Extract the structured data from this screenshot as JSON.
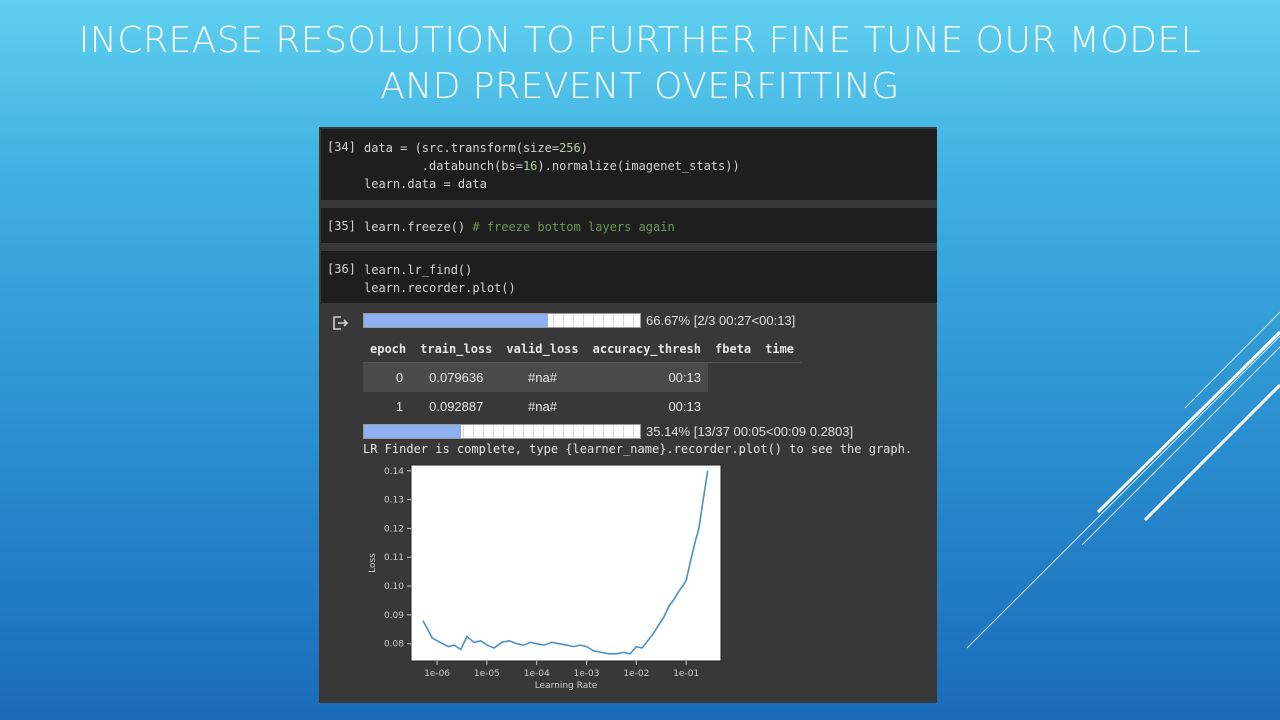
{
  "slide": {
    "title_line1": "INCREASE RESOLUTION TO FURTHER FINE TUNE OUR MODEL",
    "title_line2": "AND PREVENT OVERFITTING"
  },
  "cells": [
    {
      "prompt": "[34]",
      "lines": [
        [
          {
            "t": "data = (src.transform(size="
          },
          {
            "t": "256",
            "c": "num"
          },
          {
            "t": ")"
          }
        ],
        [
          {
            "t": "        .databunch(bs="
          },
          {
            "t": "16",
            "c": "num"
          },
          {
            "t": ").normalize(imagenet_stats))"
          }
        ],
        [
          {
            "t": "learn.data = data"
          }
        ]
      ]
    },
    {
      "prompt": "[35]",
      "lines": [
        [
          {
            "t": "learn.freeze() "
          },
          {
            "t": "# freeze bottom layers again",
            "c": "com"
          }
        ]
      ]
    },
    {
      "prompt": "[36]",
      "lines": [
        [
          {
            "t": "learn.lr_find()"
          }
        ],
        [
          {
            "t": "learn.recorder.plot()"
          }
        ]
      ]
    }
  ],
  "output": {
    "progress1": {
      "fraction": 0.6667,
      "text": "66.67% [2/3 00:27<00:13]"
    },
    "table": {
      "headers": [
        "epoch",
        "train_loss",
        "valid_loss",
        "accuracy_thresh",
        "fbeta",
        "time"
      ],
      "rows": [
        [
          "0",
          "0.079636",
          "#na#",
          "",
          "",
          "00:13"
        ],
        [
          "1",
          "0.092887",
          "#na#",
          "",
          "",
          "00:13"
        ]
      ]
    },
    "progress2": {
      "fraction": 0.3514,
      "text": "35.14% [13/37 00:05<00:09 0.2803]"
    },
    "lr_text": "LR Finder is complete, type {learner_name}.recorder.plot() to see the graph."
  },
  "chart_data": {
    "type": "line",
    "xlabel": "Learning Rate",
    "ylabel": "Loss",
    "x_scale": "log",
    "xlim": [
      3e-07,
      0.5
    ],
    "ylim": [
      0.074,
      0.142
    ],
    "x_ticks": [
      {
        "v": 1e-06,
        "label": "1e-06"
      },
      {
        "v": 1e-05,
        "label": "1e-05"
      },
      {
        "v": 0.0001,
        "label": "1e-04"
      },
      {
        "v": 0.001,
        "label": "1e-03"
      },
      {
        "v": 0.01,
        "label": "1e-02"
      },
      {
        "v": 0.1,
        "label": "1e-01"
      }
    ],
    "y_ticks": [
      {
        "v": 0.08,
        "label": "0.08"
      },
      {
        "v": 0.09,
        "label": "0.09"
      },
      {
        "v": 0.1,
        "label": "0.10"
      },
      {
        "v": 0.11,
        "label": "0.11"
      },
      {
        "v": 0.12,
        "label": "0.12"
      },
      {
        "v": 0.13,
        "label": "0.13"
      },
      {
        "v": 0.14,
        "label": "0.14"
      }
    ],
    "series": [
      {
        "color": "#4a90c8",
        "x": [
          5.2e-07,
          6.5e-07,
          8e-07,
          1e-06,
          1.3e-06,
          1.7e-06,
          2.2e-06,
          3e-06,
          4e-06,
          5.5e-06,
          7.5e-06,
          1e-05,
          1.4e-05,
          2e-05,
          2.8e-05,
          4e-05,
          5.5e-05,
          7.5e-05,
          0.0001,
          0.00014,
          0.0002,
          0.00028,
          0.0004,
          0.00055,
          0.00075,
          0.001,
          0.0014,
          0.002,
          0.0028,
          0.004,
          0.0055,
          0.0075,
          0.01,
          0.013,
          0.017,
          0.022,
          0.028,
          0.035,
          0.045,
          0.055,
          0.07,
          0.085,
          0.1,
          0.12,
          0.15,
          0.18,
          0.22,
          0.27
        ],
        "y": [
          0.088,
          0.085,
          0.082,
          0.081,
          0.08,
          0.079,
          0.0795,
          0.078,
          0.0825,
          0.0805,
          0.081,
          0.0795,
          0.0785,
          0.0805,
          0.081,
          0.08,
          0.0795,
          0.0805,
          0.08,
          0.0795,
          0.0805,
          0.08,
          0.0795,
          0.079,
          0.0795,
          0.079,
          0.0775,
          0.077,
          0.0765,
          0.0765,
          0.077,
          0.0765,
          0.079,
          0.0785,
          0.081,
          0.0835,
          0.0865,
          0.089,
          0.093,
          0.095,
          0.098,
          0.1,
          0.102,
          0.108,
          0.115,
          0.12,
          0.13,
          0.14
        ]
      }
    ]
  }
}
